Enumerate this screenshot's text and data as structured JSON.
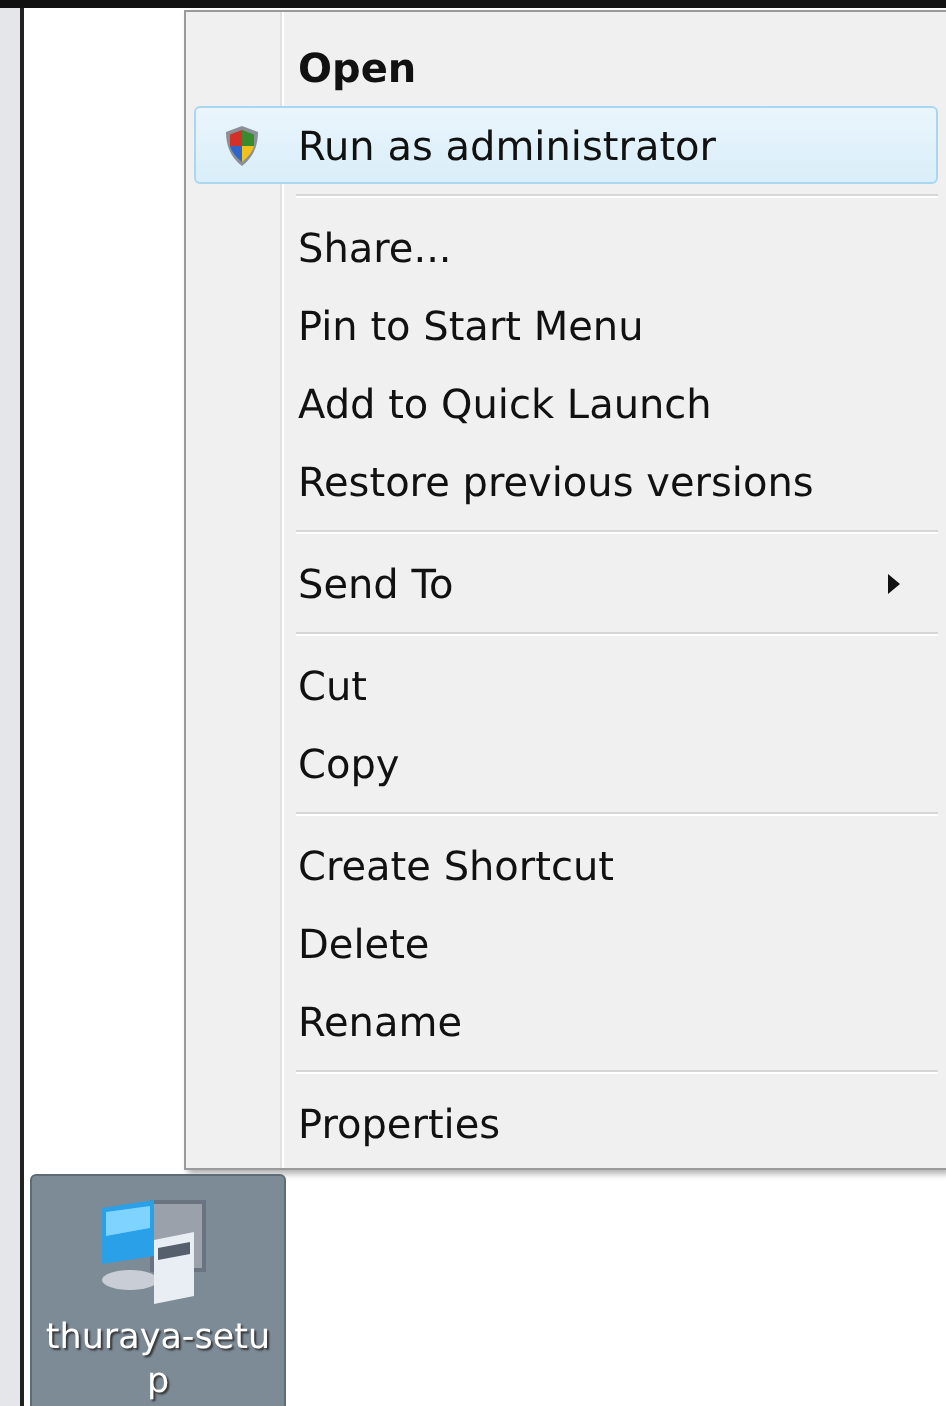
{
  "context_menu": {
    "groups": [
      [
        {
          "label": "Open",
          "default": true,
          "selected": false,
          "shield": false,
          "submenu": false
        },
        {
          "label": "Run as administrator",
          "default": false,
          "selected": true,
          "shield": true,
          "submenu": false
        }
      ],
      [
        {
          "label": "Share...",
          "default": false,
          "selected": false,
          "shield": false,
          "submenu": false
        },
        {
          "label": "Pin to Start Menu",
          "default": false,
          "selected": false,
          "shield": false,
          "submenu": false
        },
        {
          "label": "Add to Quick Launch",
          "default": false,
          "selected": false,
          "shield": false,
          "submenu": false
        },
        {
          "label": "Restore previous versions",
          "default": false,
          "selected": false,
          "shield": false,
          "submenu": false
        }
      ],
      [
        {
          "label": "Send To",
          "default": false,
          "selected": false,
          "shield": false,
          "submenu": true
        }
      ],
      [
        {
          "label": "Cut",
          "default": false,
          "selected": false,
          "shield": false,
          "submenu": false
        },
        {
          "label": "Copy",
          "default": false,
          "selected": false,
          "shield": false,
          "submenu": false
        }
      ],
      [
        {
          "label": "Create Shortcut",
          "default": false,
          "selected": false,
          "shield": false,
          "submenu": false
        },
        {
          "label": "Delete",
          "default": false,
          "selected": false,
          "shield": false,
          "submenu": false
        },
        {
          "label": "Rename",
          "default": false,
          "selected": false,
          "shield": false,
          "submenu": false
        }
      ],
      [
        {
          "label": "Properties",
          "default": false,
          "selected": false,
          "shield": false,
          "submenu": false
        }
      ]
    ]
  },
  "desktop_icons": [
    {
      "label": "thuraya-setup",
      "selected": true
    }
  ]
}
